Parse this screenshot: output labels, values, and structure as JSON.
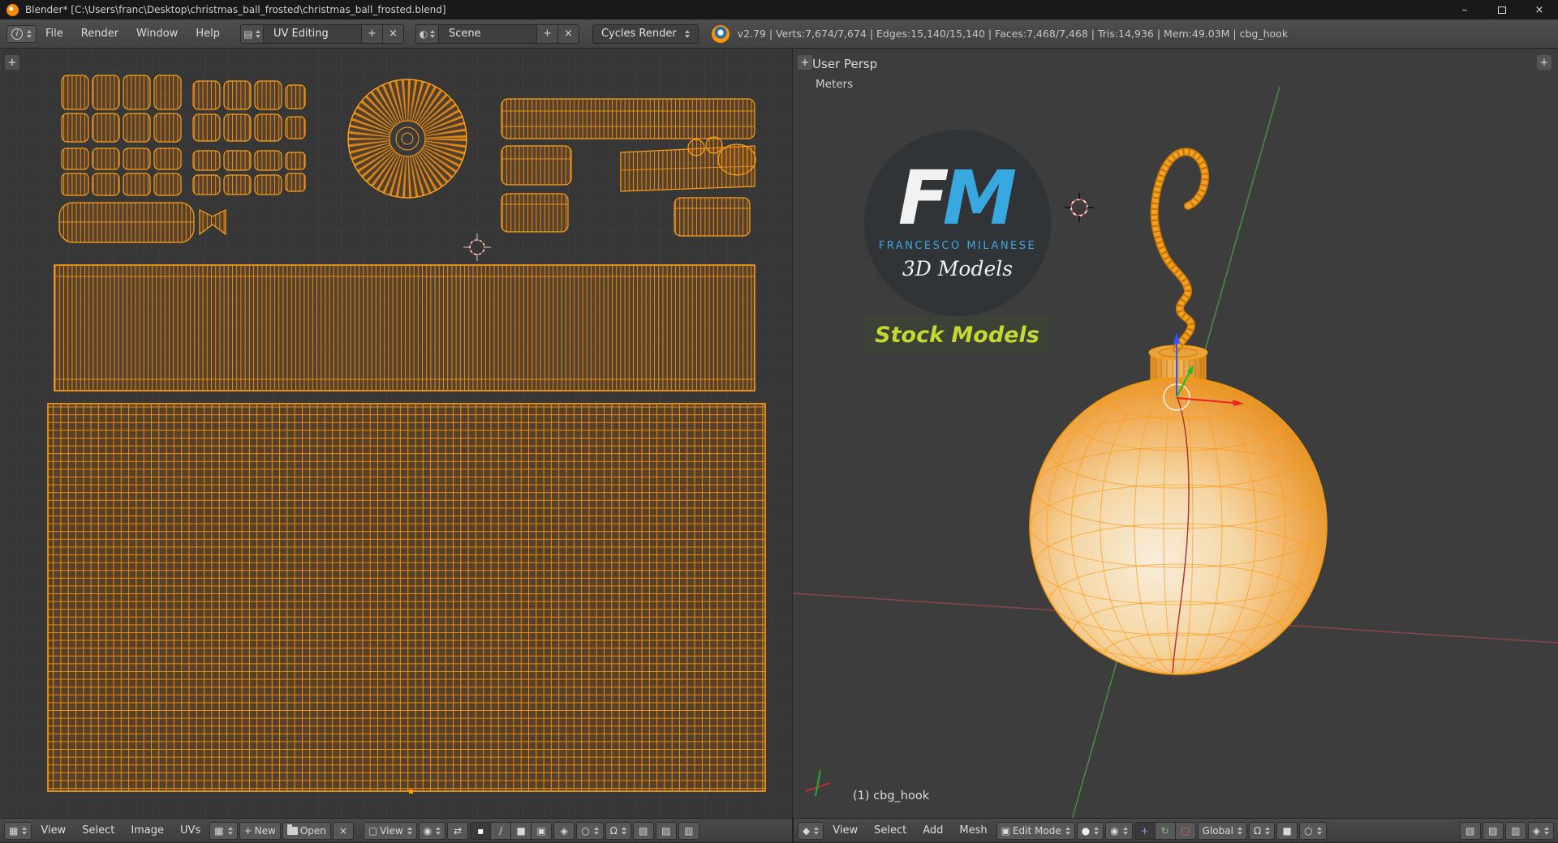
{
  "window": {
    "title": "Blender* [C:\\Users\\franc\\Desktop\\christmas_ball_frosted\\christmas_ball_frosted.blend]"
  },
  "info_header": {
    "menus": [
      "File",
      "Render",
      "Window",
      "Help"
    ],
    "layout_name": "UV Editing",
    "scene_name": "Scene",
    "engine": "Cycles Render",
    "stats": "v2.79 | Verts:7,674/7,674 | Edges:15,140/15,140 | Faces:7,468/7,468 | Tris:14,936 | Mem:49.03M | cbg_hook"
  },
  "uv_editor": {
    "menus": [
      "View",
      "Select",
      "Image",
      "UVs"
    ],
    "new_label": "New",
    "open_label": "Open",
    "mode_label": "View"
  },
  "viewport3d": {
    "menus": [
      "View",
      "Select",
      "Add",
      "Mesh"
    ],
    "mode_label": "Edit Mode",
    "orientation_label": "Global",
    "view_name": "User Persp",
    "units": "Meters",
    "object_info": "(1) cbg_hook"
  },
  "logo": {
    "letter_f": "F",
    "letter_m": "M",
    "author": "FRANCESCO MILANESE",
    "tagline": "3D Models",
    "badge": "Stock Models"
  },
  "colors": {
    "wire_orange": "#ffa114",
    "logo_blue": "#38a8e0",
    "badge_green": "#c6d834",
    "axis_green": "#4e8a4e",
    "axis_red": "#8a4646"
  },
  "icons": {
    "info": "i",
    "minimize": "–",
    "close": "×",
    "plus": "+",
    "x_small": "×",
    "editor_uv": "▦",
    "editor_3d": "◆",
    "image": "▦",
    "layout": "▤",
    "scene": "◐",
    "mode_view_icon": "▢",
    "pivot": "◉",
    "sync": "⇄",
    "vertex": "▪",
    "edge": "∕",
    "face": "■",
    "island": "▣",
    "sticky": "◈",
    "proportional": "○",
    "magnet": "Ω",
    "stipple1": "▧",
    "stipple2": "▨",
    "stipple3": "▥",
    "edit_mode_icon": "▣",
    "shading": "●",
    "manip_translate": "+",
    "manip_rotate": "↻",
    "manip_scale": "▢"
  }
}
